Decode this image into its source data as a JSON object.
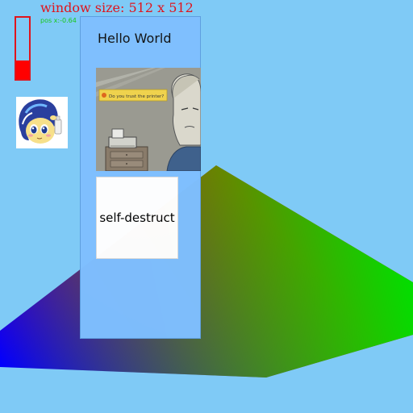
{
  "window": {
    "size_text": "window size: 512 x 512",
    "pos_text": "pos x:-0.64"
  },
  "meter": {
    "level": 0.3,
    "color": "#ff0000"
  },
  "avatar": {
    "icon": "pony-avatar-icon"
  },
  "panel": {
    "title": "Hello World",
    "comic": {
      "banner_text": "Do you trust the printer?",
      "icon": "printer-comic-image"
    },
    "button_label": "self-destruct"
  },
  "colors": {
    "background": "#7fcaf6",
    "panel": "#7fbfff",
    "triangle_red": "#ff0000",
    "triangle_green": "#00e000",
    "triangle_blue": "#0000ff"
  }
}
